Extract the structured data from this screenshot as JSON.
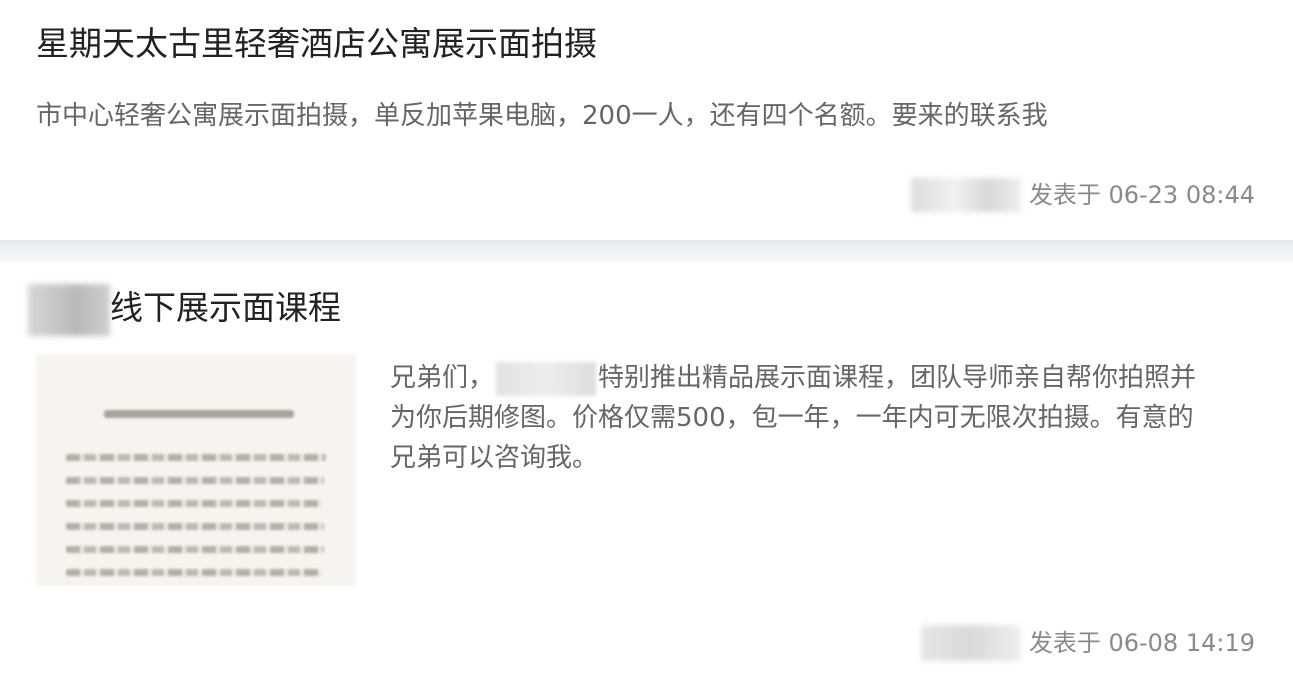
{
  "posts": [
    {
      "title": "星期天太古里轻奢酒店公寓展示面拍摄",
      "summary": "市中心轻奢公寓展示面拍摄，单反加苹果电脑，200一人，还有四个名额。要来的联系我",
      "meta": "发表于 06-23 08:44"
    },
    {
      "title": "线下展示面课程",
      "body_lines": [
        {
          "before": "兄弟们，",
          "after": "特别推出精品展示面课程，团队导师亲自帮你拍照并"
        },
        {
          "text": "为你后期修图。价格仅需500，包一年，一年内可无限次拍摄。有意的"
        },
        {
          "text": "兄弟可以咨询我。"
        }
      ],
      "meta": "发表于 06-08 14:19"
    }
  ]
}
